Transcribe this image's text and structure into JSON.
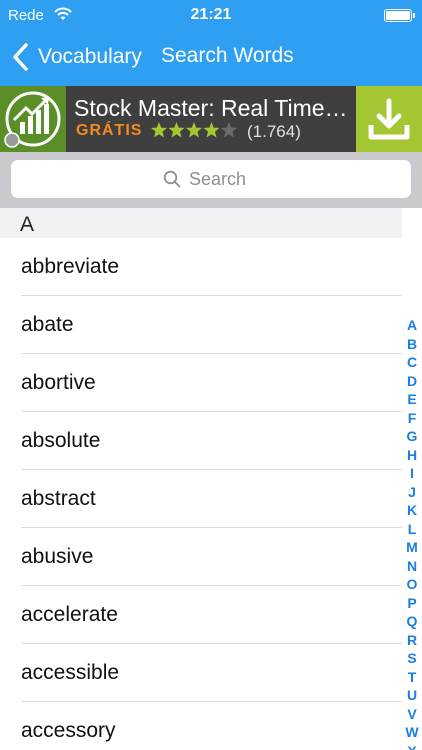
{
  "status_bar": {
    "carrier": "Rede",
    "time": "21:21"
  },
  "nav": {
    "back_label": "Vocabulary",
    "title": "Search Words"
  },
  "ad": {
    "app_name": "Stock Master: Real Time ...",
    "price": "GRÁTIS",
    "rating_stars": 4.5,
    "review_count": "(1.764)"
  },
  "search": {
    "placeholder": "Search",
    "value": ""
  },
  "section": {
    "letter": "A"
  },
  "words": [
    "abbreviate",
    "abate",
    "abortive",
    "absolute",
    "abstract",
    "abusive",
    "accelerate",
    "accessible",
    "accessory"
  ],
  "index_letters": [
    "A",
    "B",
    "C",
    "D",
    "E",
    "F",
    "G",
    "H",
    "I",
    "J",
    "K",
    "L",
    "M",
    "N",
    "O",
    "P",
    "Q",
    "R",
    "S",
    "T",
    "U",
    "V",
    "W",
    "X"
  ],
  "colors": {
    "nav_bar": "#2f9ff2",
    "ad_background": "#3f3f3f",
    "ad_price": "#f58a1f",
    "ad_download": "#a3c632",
    "index_letter": "#1a7fe0"
  }
}
